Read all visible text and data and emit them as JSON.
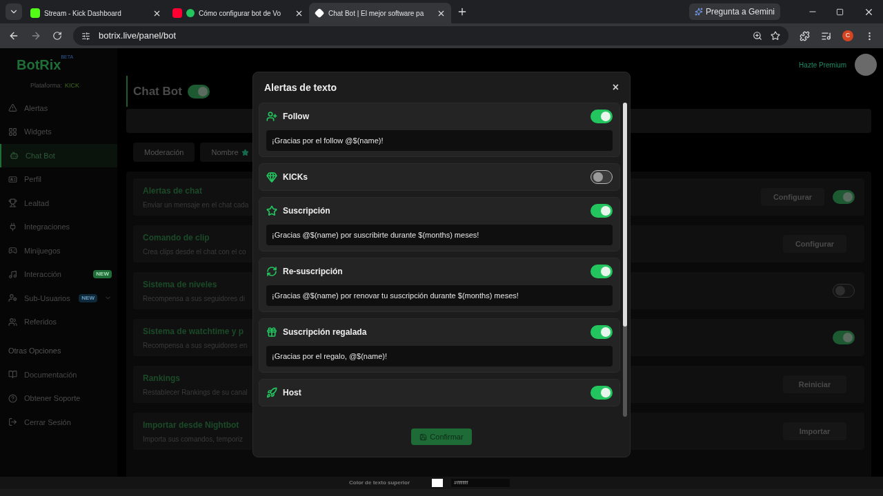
{
  "browser": {
    "tabs": [
      {
        "title": "Stream - Kick Dashboard",
        "selected": false
      },
      {
        "title": "Cómo configurar bot de Vo",
        "selected": false
      },
      {
        "title": "Chat Bot | El mejor software pa",
        "selected": true
      }
    ],
    "gemini": "Pregunta a Gemini",
    "url": "botrix.live/panel/bot",
    "profile": "C"
  },
  "sidebar": {
    "logo": "BotRix",
    "logo_badge": "BETA",
    "platform_label": "Plataforma:",
    "platform": "KICK",
    "items": [
      {
        "label": "Alertas",
        "selected": false
      },
      {
        "label": "Widgets",
        "selected": false
      },
      {
        "label": "Chat Bot",
        "selected": true
      },
      {
        "label": "Perfil",
        "selected": false
      },
      {
        "label": "Lealtad",
        "selected": false
      },
      {
        "label": "Integraciones",
        "selected": false
      },
      {
        "label": "Minijuegos",
        "selected": false
      },
      {
        "label": "Interacción",
        "selected": false,
        "badge": "NEW"
      },
      {
        "label": "Sub-Usuarios",
        "selected": false,
        "badge": "NEW",
        "expandable": true
      },
      {
        "label": "Referidos",
        "selected": false
      }
    ],
    "section": "Otras Opciones",
    "other_items": [
      "Documentación",
      "Obtener Soporte",
      "Cerrar Sesión"
    ]
  },
  "header": {
    "premium": "Hazte Premium"
  },
  "main": {
    "title": "Chat Bot",
    "enabled": true,
    "tabs": [
      {
        "label": "Moderación",
        "selected": false
      },
      {
        "label": "Nombre",
        "selected": false
      }
    ],
    "features": [
      {
        "title": "Alertas de chat",
        "description": "Enviar un mensaje en el chat cada",
        "button": "Configurar",
        "on": true
      },
      {
        "title": "Comando de clip",
        "description": "Crea clips desde el chat con el co",
        "button": "Configurar"
      },
      {
        "title": "Sistema de niveles",
        "description": "Recompensa a sus seguidores di",
        "on": false
      },
      {
        "title": "Sistema de watchtime y p",
        "description": "Recompensa a sus seguidores en",
        "on": true
      },
      {
        "title": "Rankings",
        "description": "Restablecer Rankings de su canal",
        "button": "Reiniciar"
      },
      {
        "title": "Importar desde Nightbot",
        "description": "Importa sus comandos, temporiz",
        "button": "Importar"
      }
    ]
  },
  "modal": {
    "title": "Alertas de texto",
    "close": "×",
    "alerts": [
      {
        "label": "Follow",
        "on": true,
        "message": "¡Gracias por el follow @$(name)!"
      },
      {
        "label": "KICKs",
        "on": false
      },
      {
        "label": "Suscripción",
        "on": true,
        "message": "¡Gracias @$(name) por suscribirte durante $(months) meses!"
      },
      {
        "label": "Re-suscripción",
        "on": true,
        "message": "¡Gracias @$(name) por renovar tu suscripción durante $(months) meses!"
      },
      {
        "label": "Suscripción regalada",
        "on": true,
        "message": "¡Gracias por el regalo, @$(name)!"
      },
      {
        "label": "Host",
        "on": true
      }
    ],
    "confirm": "Confirmar"
  },
  "bottom_bar": {
    "label": "Color de texto superior",
    "color": "#ffffff",
    "value": "#ffffff"
  }
}
